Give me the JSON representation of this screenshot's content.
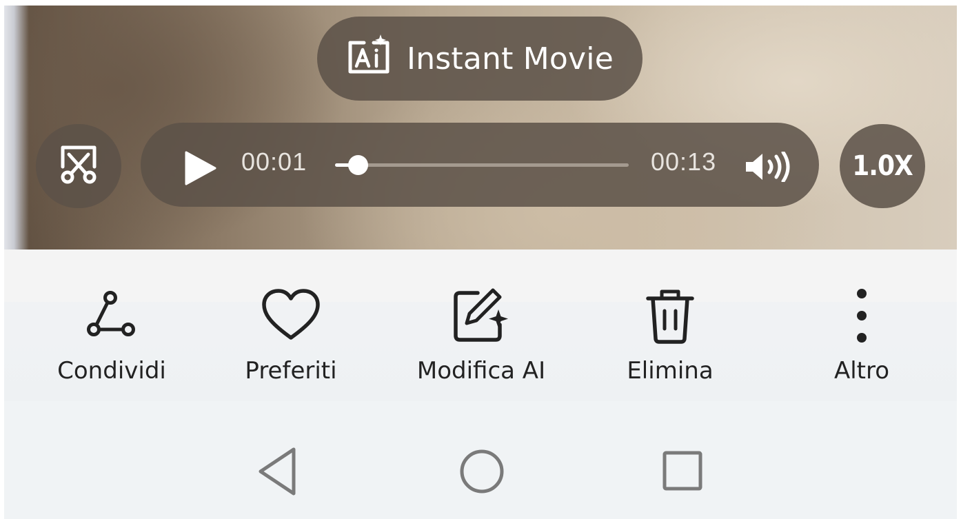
{
  "player": {
    "instant_movie_label": "Instant Movie",
    "current_time": "00:01",
    "total_time": "00:13",
    "progress": 0.077,
    "speed_label": "1.0X"
  },
  "actions": [
    {
      "label": "Condividi",
      "icon": "share-icon"
    },
    {
      "label": "Preferiti",
      "icon": "heart-icon"
    },
    {
      "label": "Modifica AI",
      "icon": "ai-edit-icon"
    },
    {
      "label": "Elimina",
      "icon": "trash-icon"
    },
    {
      "label": "Altro",
      "icon": "more-vertical-icon"
    }
  ],
  "nav": [
    "back-icon",
    "home-icon",
    "recents-icon"
  ],
  "colors": {
    "overlay_pill": "#5c5248",
    "text_dark": "#222222",
    "background": "#f0f3f5",
    "nav_icon": "#7a7a7a"
  }
}
